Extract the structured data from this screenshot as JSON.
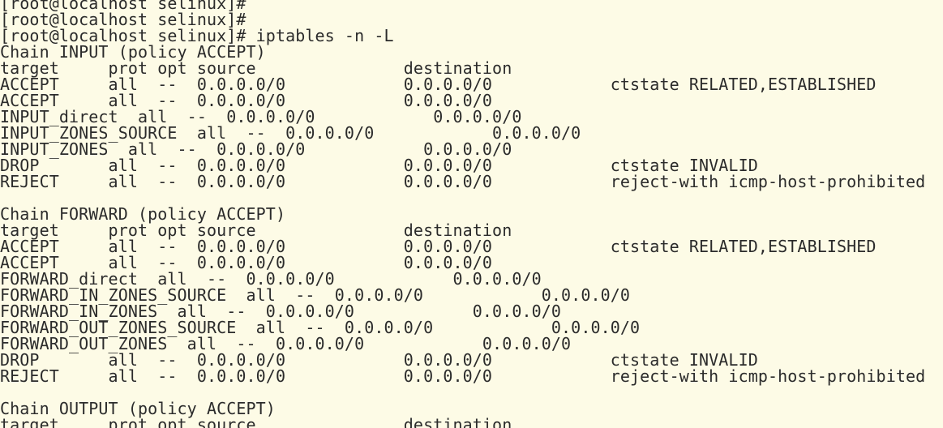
{
  "terminal": {
    "lines": [
      "[root@localhost selinux]#",
      "[root@localhost selinux]#",
      "[root@localhost selinux]# iptables -n -L",
      "Chain INPUT (policy ACCEPT)",
      "target     prot opt source               destination",
      "ACCEPT     all  --  0.0.0.0/0            0.0.0.0/0            ctstate RELATED,ESTABLISHED",
      "ACCEPT     all  --  0.0.0.0/0            0.0.0.0/0",
      "INPUT_direct  all  --  0.0.0.0/0            0.0.0.0/0",
      "INPUT_ZONES_SOURCE  all  --  0.0.0.0/0            0.0.0.0/0",
      "INPUT_ZONES  all  --  0.0.0.0/0            0.0.0.0/0",
      "DROP       all  --  0.0.0.0/0            0.0.0.0/0            ctstate INVALID",
      "REJECT     all  --  0.0.0.0/0            0.0.0.0/0            reject-with icmp-host-prohibited",
      "",
      "Chain FORWARD (policy ACCEPT)",
      "target     prot opt source               destination",
      "ACCEPT     all  --  0.0.0.0/0            0.0.0.0/0            ctstate RELATED,ESTABLISHED",
      "ACCEPT     all  --  0.0.0.0/0            0.0.0.0/0",
      "FORWARD_direct  all  --  0.0.0.0/0            0.0.0.0/0",
      "FORWARD_IN_ZONES_SOURCE  all  --  0.0.0.0/0            0.0.0.0/0",
      "FORWARD_IN_ZONES  all  --  0.0.0.0/0            0.0.0.0/0",
      "FORWARD_OUT_ZONES_SOURCE  all  --  0.0.0.0/0            0.0.0.0/0",
      "FORWARD_OUT_ZONES  all  --  0.0.0.0/0            0.0.0.0/0",
      "DROP       all  --  0.0.0.0/0            0.0.0.0/0            ctstate INVALID",
      "REJECT     all  --  0.0.0.0/0            0.0.0.0/0            reject-with icmp-host-prohibited",
      "",
      "Chain OUTPUT (policy ACCEPT)",
      "target     prot opt source               destination"
    ]
  }
}
